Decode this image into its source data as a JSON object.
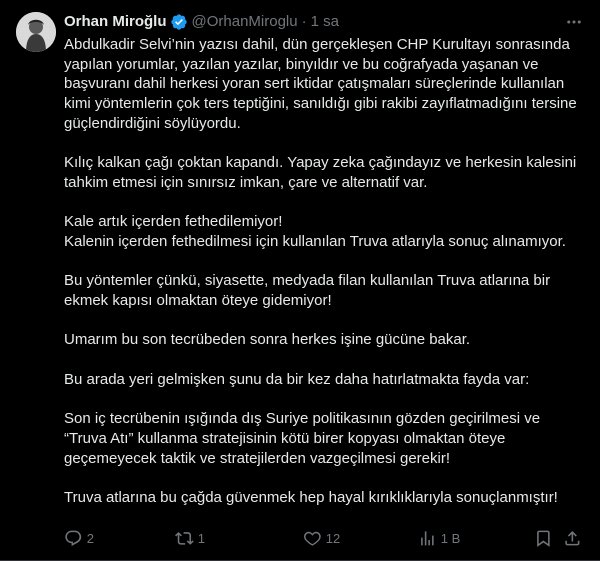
{
  "tweet": {
    "author_name": "Orhan Miroğlu",
    "handle": "@OrhanMiroglu",
    "separator": "·",
    "time": "1 sa",
    "paragraphs": [
      [
        "Abdulkadir Selvi’nin yazısı dahil, dün gerçekleşen CHP Kurultayı sonrasında yapılan yorumlar, yazılan yazılar, binyıldır ve bu coğrafyada yaşanan ve başvuranı dahil herkesi yoran sert iktidar çatışmaları süreçlerinde kullanılan kimi yöntemlerin çok ters teptiğini, sanıldığı gibi rakibi zayıflatmadığını tersine güçlendirdiğini söylüyordu."
      ],
      [
        "Kılıç kalkan çağı çoktan kapandı. Yapay zeka çağındayız ve herkesin kalesini tahkim etmesi için sınırsız imkan, çare ve alternatif var."
      ],
      [
        "Kale artık içerden fethedilemiyor!",
        "Kalenin içerden fethedilmesi için kullanılan Truva atlarıyla sonuç alınamıyor."
      ],
      [
        "Bu yöntemler çünkü, siyasette, medyada filan kullanılan Truva atlarına bir ekmek kapısı olmaktan öteye gidemiyor!"
      ],
      [
        "Umarım bu son tecrübeden sonra herkes işine gücüne bakar."
      ],
      [
        "Bu arada yeri gelmişken şunu da bir kez daha hatırlatmakta fayda var:"
      ],
      [
        "Son iç tecrübenin ışığında dış Suriye politikasının gözden geçirilmesi ve “Truva Atı” kullanma stratejisinin kötü birer kopyası olmaktan öteye geçemeyecek taktik ve stratejilerden vazgeçilmesi gerekir!"
      ],
      [
        "Truva atlarına bu çağda güvenmek hep hayal kırıklıklarıyla sonuçlanmıştır!"
      ]
    ]
  },
  "actions": {
    "replies": "2",
    "retweets": "1",
    "likes": "12",
    "views": "1 B"
  },
  "colors": {
    "background": "#000000",
    "text": "#e7e9ea",
    "muted": "#71767b",
    "verified": "#1d9bf0"
  },
  "icons": [
    "more-icon",
    "verified-badge-icon",
    "reply-icon",
    "retweet-icon",
    "like-icon",
    "views-icon",
    "bookmark-icon",
    "share-icon"
  ]
}
